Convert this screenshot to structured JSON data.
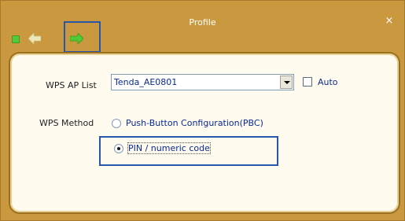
{
  "window": {
    "title": "Profile",
    "close_glyph": "×"
  },
  "toolbar": {
    "icons": [
      "stop-icon",
      "back-arrow-icon",
      "forward-arrow-icon"
    ]
  },
  "wps": {
    "ap_list_label": "WPS AP List",
    "ap_selected": "Tenda_AE0801",
    "auto_label": "Auto",
    "auto_checked": false,
    "method_label": "WPS Method",
    "methods": [
      {
        "label": "Push-Button Configuration(PBC)",
        "selected": false
      },
      {
        "label": "PIN / numeric code",
        "selected": true
      }
    ]
  },
  "colors": {
    "frame": "#c9983f",
    "panel": "#fffbef",
    "link_text": "#0a2a8f",
    "highlight": "#2757a6",
    "arrow_back": "#e8e4b0",
    "arrow_forward": "#49c630"
  }
}
